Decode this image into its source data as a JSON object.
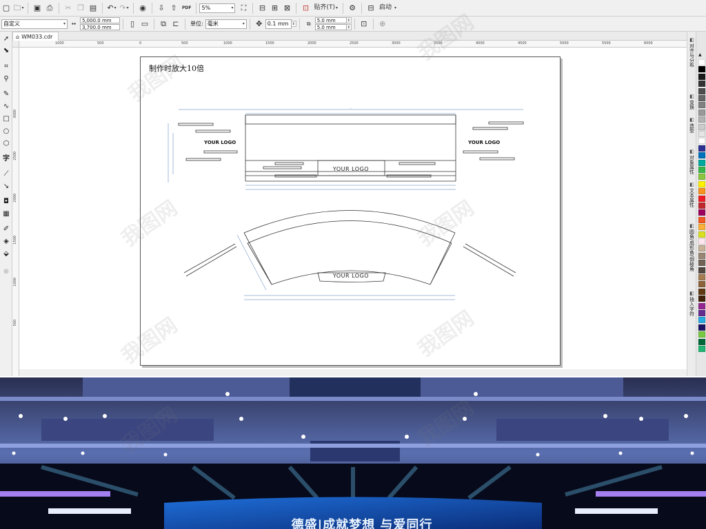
{
  "standard_toolbar": {
    "snap_label": "贴齐(T)",
    "launch_label": "启动",
    "zoom_value": "5%",
    "pdf_label": "PDF"
  },
  "property_bar": {
    "page_preset": "自定义",
    "width": "5,000.0 mm",
    "height": "3,700.0 mm",
    "units_label": "单位:",
    "units_value": "毫米",
    "nudge": "0.1 mm",
    "dup_x": "5.0 mm",
    "dup_y": "5.0 mm"
  },
  "document_tab": {
    "name": "WM033.cdr"
  },
  "ruler": {
    "h_labels": [
      "1000",
      "500",
      "0",
      "500",
      "1000",
      "1500",
      "2000",
      "2500",
      "3000",
      "3500",
      "4000",
      "4500",
      "5000",
      "5500",
      "6000"
    ],
    "v_labels": [
      "3000",
      "2500",
      "2000",
      "1500",
      "1000",
      "500"
    ]
  },
  "drawing": {
    "note": "制作时放大10倍",
    "logo_text": "YOUR LOGO"
  },
  "dockers": [
    {
      "label": "对齐与分布",
      "icon": "align-icon"
    },
    {
      "label": "变换",
      "icon": "transform-icon"
    },
    {
      "label": "造型",
      "icon": "shaping-icon"
    },
    {
      "label": "对象属性",
      "icon": "object-props-icon"
    },
    {
      "label": "文本属性",
      "icon": "text-props-icon"
    },
    {
      "label": "圆角/扇形角/倒棱角",
      "icon": "fillet-icon"
    },
    {
      "label": "插入字符",
      "icon": "insert-char-icon"
    }
  ],
  "palette_colors": [
    "#ffffff",
    "#000000",
    "#1a1a1a",
    "#333333",
    "#4d4d4d",
    "#666666",
    "#808080",
    "#999999",
    "#b3b3b3",
    "#cccccc",
    "#e6e6e6",
    "#ffffff",
    "#2e3192",
    "#0071bc",
    "#00a99d",
    "#39b54a",
    "#8cc63f",
    "#fff200",
    "#f7931e",
    "#ed1c24",
    "#c1272d",
    "#9e005d",
    "#f15a24",
    "#fbb03b",
    "#d9e021",
    "#ffe7ef",
    "#c7b299",
    "#998675",
    "#736357",
    "#534741",
    "#a67c52",
    "#8c6239",
    "#603813",
    "#42210b",
    "#93278f",
    "#662d91",
    "#29abe2",
    "#1b1464",
    "#7ac943",
    "#006837",
    "#22b573"
  ],
  "render_banner": {
    "text": "德盛|成就梦想 与爱同行"
  },
  "watermark": "我图网"
}
